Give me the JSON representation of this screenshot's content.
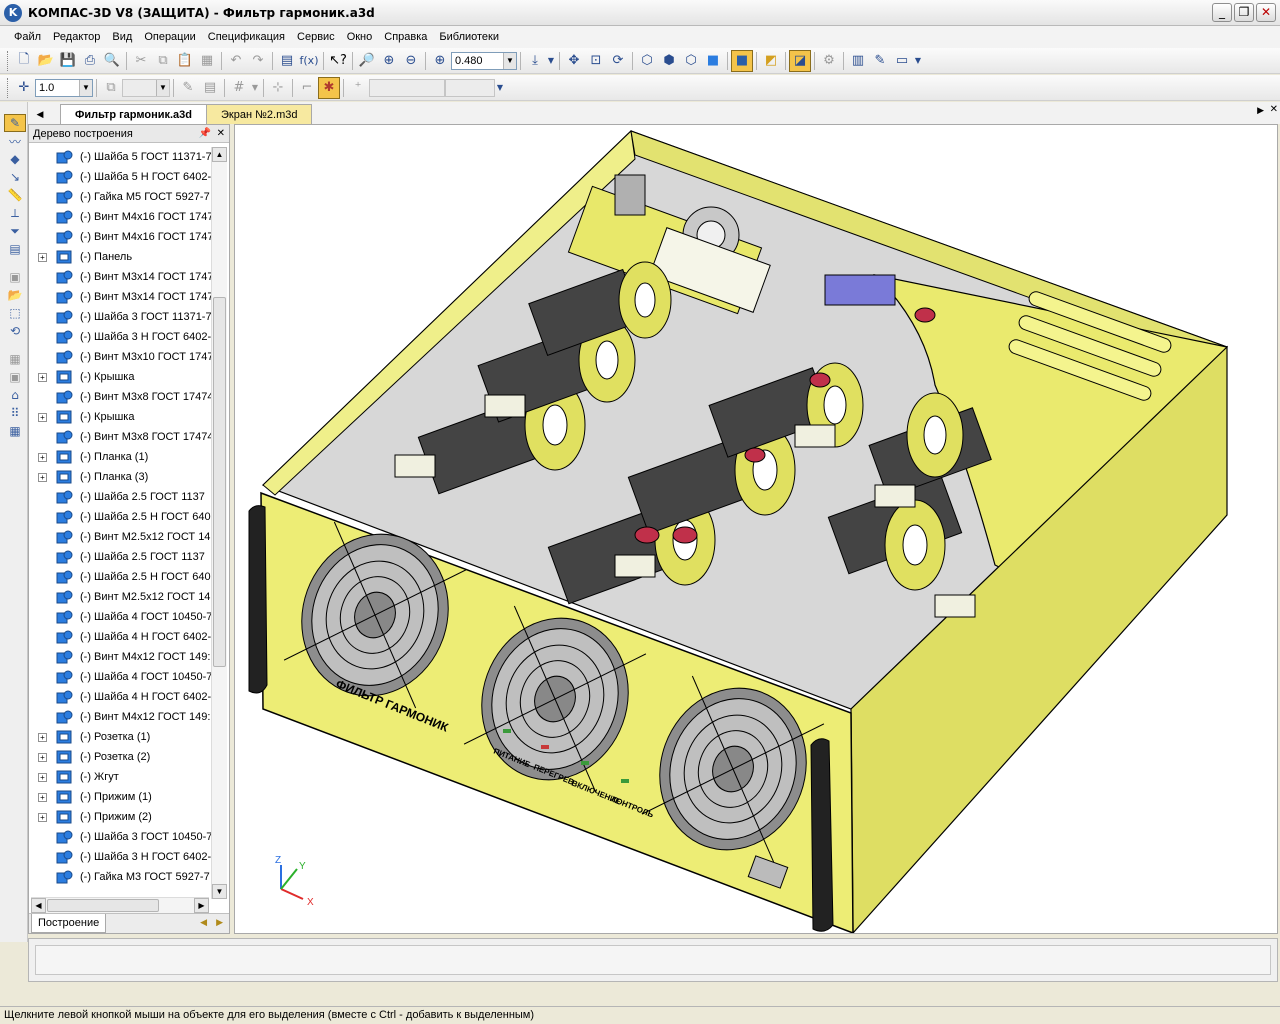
{
  "window": {
    "title": "КОМПАС-3D V8 (ЗАЩИТА) - Фильтр гармоник.a3d",
    "minimize": "_",
    "maximize": "❐",
    "close": "✕",
    "logo": "K"
  },
  "menu": [
    "Файл",
    "Редактор",
    "Вид",
    "Операции",
    "Спецификация",
    "Сервис",
    "Окно",
    "Справка",
    "Библиотеки"
  ],
  "toolbar": {
    "zoom_value": "0.480",
    "step_value": "1.0"
  },
  "tabs": [
    {
      "label": "Фильтр гармоник.a3d",
      "active": true
    },
    {
      "label": "Экран №2.m3d",
      "active": false
    }
  ],
  "tree_panel": {
    "title": "Дерево построения",
    "footer_tab": "Построение",
    "items": [
      {
        "label": "(-) Шайба 5 ГОСТ 11371-7",
        "icon": "part-icon",
        "expandable": false
      },
      {
        "label": "(-) Шайба 5 Н ГОСТ 6402-",
        "icon": "part-icon",
        "expandable": false
      },
      {
        "label": "(-) Гайка М5 ГОСТ 5927-7",
        "icon": "part-icon",
        "expandable": false
      },
      {
        "label": "(-) Винт М4х16 ГОСТ 1747",
        "icon": "part-icon",
        "expandable": false
      },
      {
        "label": "(-) Винт М4х16 ГОСТ 1747",
        "icon": "part-icon",
        "expandable": false
      },
      {
        "label": "(-) Панель",
        "icon": "assembly-icon",
        "expandable": true
      },
      {
        "label": "(-) Винт М3х14 ГОСТ 1747",
        "icon": "part-icon",
        "expandable": false
      },
      {
        "label": "(-) Винт М3х14 ГОСТ 1747",
        "icon": "part-icon",
        "expandable": false
      },
      {
        "label": "(-) Шайба 3 ГОСТ 11371-7",
        "icon": "part-icon",
        "expandable": false
      },
      {
        "label": "(-) Шайба 3 Н ГОСТ 6402-",
        "icon": "part-icon",
        "expandable": false
      },
      {
        "label": "(-) Винт М3х10 ГОСТ 1747",
        "icon": "part-icon",
        "expandable": false
      },
      {
        "label": "(-) Крышка",
        "icon": "assembly-icon",
        "expandable": true
      },
      {
        "label": "(-) Винт М3х8 ГОСТ 17474",
        "icon": "part-icon",
        "expandable": false
      },
      {
        "label": "(-) Крышка",
        "icon": "assembly-icon",
        "expandable": true
      },
      {
        "label": "(-) Винт М3х8 ГОСТ 17474",
        "icon": "part-icon",
        "expandable": false
      },
      {
        "label": "(-) Планка (1)",
        "icon": "assembly-icon",
        "expandable": true
      },
      {
        "label": "(-) Планка (3)",
        "icon": "assembly-icon",
        "expandable": true
      },
      {
        "label": "(-) Шайба 2.5 ГОСТ 1137",
        "icon": "part-icon",
        "expandable": false
      },
      {
        "label": "(-) Шайба 2.5 Н ГОСТ 640",
        "icon": "part-icon",
        "expandable": false
      },
      {
        "label": "(-) Винт М2.5х12 ГОСТ 14",
        "icon": "part-icon",
        "expandable": false
      },
      {
        "label": "(-) Шайба 2.5 ГОСТ 1137",
        "icon": "part-icon",
        "expandable": false
      },
      {
        "label": "(-) Шайба 2.5 Н ГОСТ 640",
        "icon": "part-icon",
        "expandable": false
      },
      {
        "label": "(-) Винт М2.5х12 ГОСТ 14",
        "icon": "part-icon",
        "expandable": false
      },
      {
        "label": "(-) Шайба 4 ГОСТ 10450-7",
        "icon": "part-icon",
        "expandable": false
      },
      {
        "label": "(-) Шайба 4 Н ГОСТ 6402-",
        "icon": "part-icon",
        "expandable": false
      },
      {
        "label": "(-) Винт М4х12 ГОСТ 149:",
        "icon": "part-icon",
        "expandable": false
      },
      {
        "label": "(-) Шайба 4 ГОСТ 10450-7",
        "icon": "part-icon",
        "expandable": false
      },
      {
        "label": "(-) Шайба 4 Н ГОСТ 6402-",
        "icon": "part-icon",
        "expandable": false
      },
      {
        "label": "(-) Винт М4х12 ГОСТ 149:",
        "icon": "part-icon",
        "expandable": false
      },
      {
        "label": "(-) Розетка (1)",
        "icon": "assembly-icon",
        "expandable": true
      },
      {
        "label": "(-) Розетка (2)",
        "icon": "assembly-icon",
        "expandable": true
      },
      {
        "label": "(-) Жгут",
        "icon": "assembly-icon",
        "expandable": true
      },
      {
        "label": "(-) Прижим (1)",
        "icon": "assembly-icon",
        "expandable": true
      },
      {
        "label": "(-) Прижим (2)",
        "icon": "assembly-icon",
        "expandable": true
      },
      {
        "label": "(-) Шайба 3 ГОСТ 10450-7",
        "icon": "part-icon",
        "expandable": false
      },
      {
        "label": "(-) Шайба 3 Н ГОСТ 6402-",
        "icon": "part-icon",
        "expandable": false
      },
      {
        "label": "(-) Гайка М3 ГОСТ 5927-7",
        "icon": "part-icon",
        "expandable": false
      }
    ]
  },
  "model": {
    "front_label": "ФИЛЬТР ГАРМОНИК",
    "indicators": [
      "ПИТАНИЕ",
      "ПЕРЕГРЕВ",
      "ВКЛЮЧЕНИЕ",
      "КОНТРОЛЬ"
    ],
    "axes": {
      "x": "X",
      "y": "Y",
      "z": "Z"
    },
    "body_color": "#e8e86a",
    "accent_color": "#2b5fa8"
  },
  "status": "Щелкните левой кнопкой мыши на объекте для его выделения (вместе с Ctrl - добавить к выделенным)"
}
